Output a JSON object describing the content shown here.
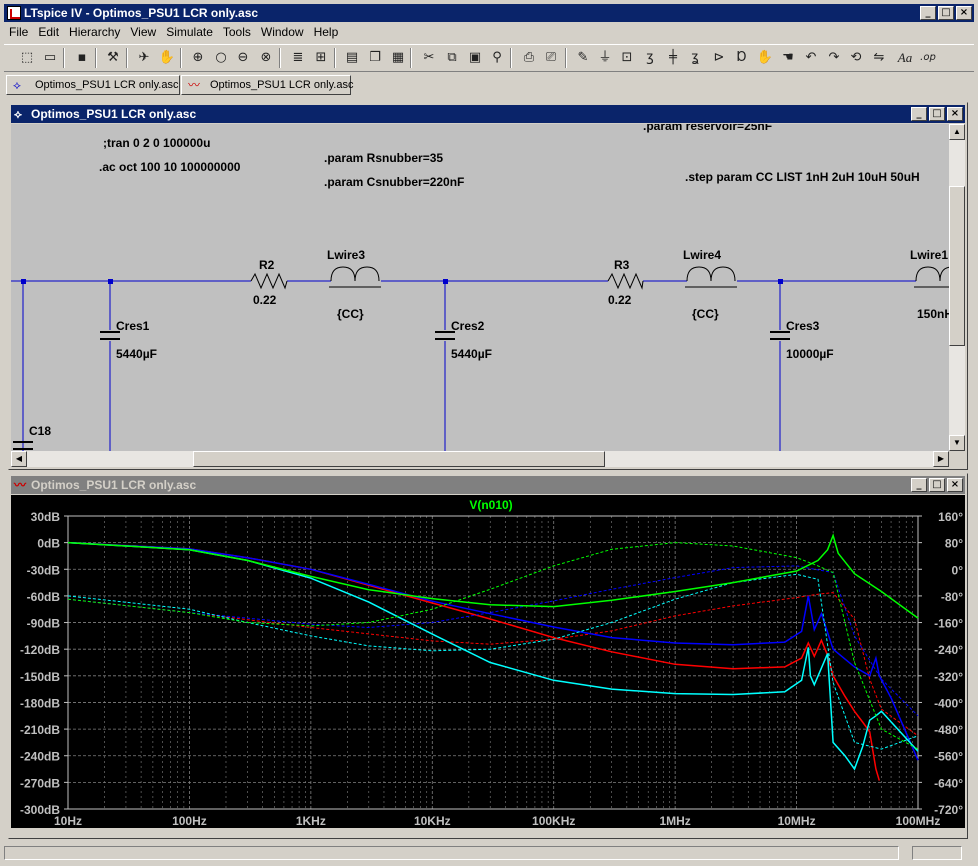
{
  "app": {
    "title": "LTspice IV - Optimos_PSU1 LCR only.asc"
  },
  "menu": [
    "File",
    "Edit",
    "Hierarchy",
    "View",
    "Simulate",
    "Tools",
    "Window",
    "Help"
  ],
  "toolbar_icons": [
    "new-schematic-icon",
    "open-icon",
    "save-icon",
    "control-panel-icon",
    "run-icon",
    "halt-icon",
    "zoom-in-icon",
    "zoom-out-icon",
    "zoom-fit-icon",
    "zoom-cancel-icon",
    "autorange-icon",
    "grid-icon",
    "tile-vertical-icon",
    "cascade-icon",
    "tile-icon",
    "cut-icon",
    "copy-icon",
    "paste-icon",
    "find-icon",
    "print-icon",
    "print-preview-icon",
    "draw-wire-icon",
    "ground-icon",
    "label-net-icon",
    "resistor-icon",
    "capacitor-icon",
    "inductor-icon",
    "diode-icon",
    "component-icon",
    "move-icon",
    "drag-icon",
    "undo-icon",
    "redo-icon",
    "rotate-icon",
    "mirror-icon",
    "text-icon",
    "spice-directive-icon"
  ],
  "tabs": [
    {
      "label": "Optimos_PSU1 LCR only.asc",
      "icon": "schematic-icon"
    },
    {
      "label": "Optimos_PSU1 LCR only.asc",
      "icon": "waveform-icon"
    }
  ],
  "schematic": {
    "title": "Optimos_PSU1 LCR only.asc",
    "directives": {
      "tran": ";tran 0 2 0 100000u",
      "ac": ".ac oct 100 10 100000000",
      "rsnubber": ".param Rsnubber=35",
      "csnubber": ".param Csnubber=220nF",
      "reservoir": ".param reservoir=25nF",
      "step": ".step param CC LIST 1nH 2uH 10uH 50uH"
    },
    "components": {
      "r2_name": "R2",
      "r2_value": "0.22",
      "lwire3_name": "Lwire3",
      "lwire3_value": "{CC}",
      "r3_name": "R3",
      "r3_value": "0.22",
      "lwire4_name": "Lwire4",
      "lwire4_value": "{CC}",
      "lwire1_name": "Lwire1",
      "lwire1_value": "150nH",
      "cres1_name": "Cres1",
      "cres1_value": "5440µF",
      "cres2_name": "Cres2",
      "cres2_value": "5440µF",
      "cres3_name": "Cres3",
      "cres3_value": "10000µF",
      "c18_name": "C18"
    },
    "colors": {
      "background": "#c0c0c0",
      "wire": "#0000cc",
      "text": "#000000"
    }
  },
  "plot": {
    "title": "Optimos_PSU1 LCR only.asc",
    "colors": {
      "background": "#000000",
      "axis_text": "#c0c0c0",
      "grid": "#808080"
    },
    "chart_data": {
      "type": "line",
      "title": "V(n010)",
      "title_color": "#00ff00",
      "x_scale": "log",
      "xlim": [
        10,
        100000000
      ],
      "x_ticks": [
        "10Hz",
        "100Hz",
        "1KHz",
        "10KHz",
        "100KHz",
        "1MHz",
        "10MHz",
        "100MHz"
      ],
      "y_left_ticks": [
        "30dB",
        "0dB",
        "-30dB",
        "-60dB",
        "-90dB",
        "-120dB",
        "-150dB",
        "-180dB",
        "-210dB",
        "-240dB",
        "-270dB",
        "-300dB"
      ],
      "ylim_left": [
        -300,
        30
      ],
      "y_right_ticks": [
        "160°",
        "80°",
        "0°",
        "-80°",
        "-160°",
        "-240°",
        "-320°",
        "-400°",
        "-480°",
        "-560°",
        "-640°",
        "-720°"
      ],
      "ylim_right": [
        -720,
        160
      ],
      "grid": true,
      "series": [
        {
          "color": "#ff0000",
          "kind": "magnitude",
          "x": [
            10,
            100,
            300,
            1000,
            3000,
            10000,
            30000,
            100000,
            300000,
            1000000,
            3000000,
            8000000,
            11000000,
            12500000,
            14000000,
            16000000,
            18000000,
            20000000,
            25000000,
            30000000,
            35000000,
            40000000,
            45000000,
            48000000
          ],
          "y": [
            0,
            -7,
            -17,
            -30,
            -48,
            -68,
            -86,
            -107,
            -123,
            -137,
            -142,
            -140,
            -130,
            -113,
            -128,
            -110,
            -127,
            -150,
            -173,
            -190,
            -202,
            -213,
            -255,
            -268
          ]
        },
        {
          "color": "#ff0000",
          "kind": "phase",
          "x": [
            10,
            100,
            1000,
            10000,
            30000,
            100000,
            300000,
            1000000,
            3000000,
            10000000,
            15000000,
            20000000,
            30000000,
            40000000,
            50000000,
            100000000
          ],
          "y": [
            -90,
            -130,
            -175,
            -215,
            -225,
            -210,
            -185,
            -140,
            -110,
            -85,
            -75,
            -70,
            -150,
            -330,
            -420,
            -500
          ]
        },
        {
          "color": "#0000ff",
          "kind": "magnitude",
          "x": [
            10,
            100,
            300,
            1000,
            3000,
            10000,
            30000,
            100000,
            300000,
            1000000,
            3000000,
            8000000,
            11000000,
            12500000,
            14000000,
            16000000,
            20000000,
            30000000,
            40000000,
            45000000,
            48000000,
            60000000,
            100000000
          ],
          "y": [
            0,
            -7,
            -17,
            -30,
            -47,
            -66,
            -80,
            -95,
            -107,
            -113,
            -115,
            -112,
            -100,
            -60,
            -98,
            -80,
            -120,
            -140,
            -150,
            -130,
            -150,
            -175,
            -245
          ]
        },
        {
          "color": "#0000ff",
          "kind": "phase",
          "x": [
            10,
            100,
            1000,
            3000,
            10000,
            30000,
            100000,
            300000,
            1000000,
            3000000,
            10000000,
            20000000,
            30000000,
            50000000,
            100000000
          ],
          "y": [
            -90,
            -130,
            -165,
            -175,
            -160,
            -130,
            -95,
            -60,
            -25,
            5,
            10,
            -10,
            -200,
            -330,
            -440
          ]
        },
        {
          "color": "#00ffff",
          "kind": "magnitude",
          "x": [
            10,
            100,
            300,
            1000,
            3000,
            10000,
            30000,
            100000,
            300000,
            1000000,
            3000000,
            8000000,
            11000000,
            12500000,
            13000000,
            14000000,
            18000000,
            20000000,
            25000000,
            30000000,
            35000000,
            40000000,
            45000000,
            50000000,
            100000000
          ],
          "y": [
            0,
            -8,
            -20,
            -40,
            -67,
            -103,
            -135,
            -155,
            -165,
            -170,
            -171,
            -168,
            -155,
            -118,
            -150,
            -160,
            -125,
            -225,
            -240,
            -255,
            -230,
            -200,
            -195,
            -190,
            -235
          ]
        },
        {
          "color": "#00ffff",
          "kind": "phase",
          "x": [
            10,
            100,
            300,
            1000,
            3000,
            10000,
            30000,
            100000,
            300000,
            1000000,
            3000000,
            10000000,
            15000000,
            20000000,
            30000000,
            50000000,
            100000000
          ],
          "y": [
            -80,
            -120,
            -160,
            -200,
            -230,
            -245,
            -240,
            -210,
            -160,
            -90,
            -40,
            -15,
            -30,
            -340,
            -520,
            -540,
            -500
          ]
        },
        {
          "color": "#00ff00",
          "kind": "magnitude",
          "x": [
            10,
            100,
            300,
            1000,
            3000,
            10000,
            30000,
            100000,
            300000,
            1000000,
            3000000,
            10000000,
            15000000,
            18000000,
            20000000,
            22000000,
            30000000,
            50000000,
            100000000
          ],
          "y": [
            0,
            -8,
            -20,
            -38,
            -53,
            -63,
            -70,
            -72,
            -65,
            -55,
            -45,
            -32,
            -20,
            -8,
            8,
            -12,
            -35,
            -55,
            -85
          ]
        },
        {
          "color": "#00ff00",
          "kind": "phase",
          "x": [
            10,
            100,
            300,
            1000,
            3000,
            10000,
            30000,
            100000,
            300000,
            1000000,
            3000000,
            10000000,
            15000000,
            20000000,
            30000000,
            50000000,
            100000000
          ],
          "y": [
            -90,
            -130,
            -160,
            -170,
            -160,
            -120,
            -60,
            10,
            60,
            80,
            70,
            35,
            10,
            -10,
            -280,
            -480,
            -540
          ]
        }
      ]
    }
  }
}
